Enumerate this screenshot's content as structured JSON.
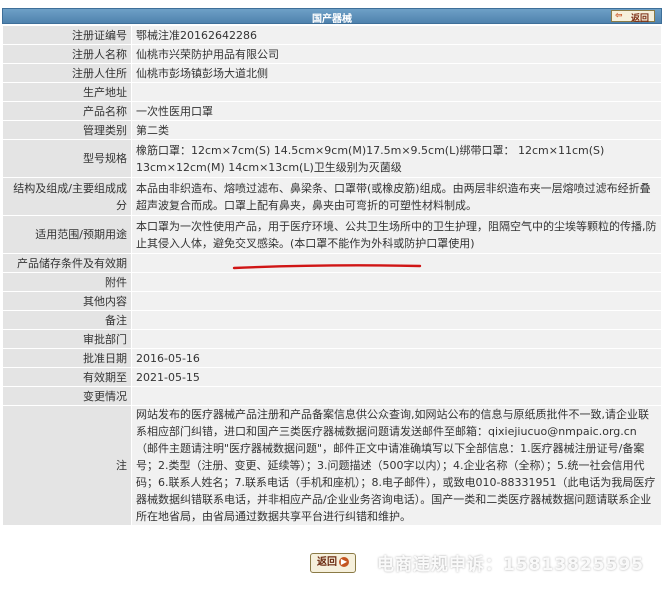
{
  "header": {
    "title": "国产器械",
    "back_label": "返回"
  },
  "rows": [
    {
      "label": "注册证编号",
      "value": "鄂械注准20162642286"
    },
    {
      "label": "注册人名称",
      "value": "仙桃市兴荣防护用品有限公司"
    },
    {
      "label": "注册人住所",
      "value": "仙桃市彭场镇彭场大道北侧"
    },
    {
      "label": "生产地址",
      "value": ""
    },
    {
      "label": "产品名称",
      "value": "一次性医用口罩"
    },
    {
      "label": "管理类别",
      "value": "第二类"
    },
    {
      "label": "型号规格",
      "value": "橡筋口罩：12cm×7cm(S) 14.5cm×9cm(M)17.5m×9.5cm(L)绑带口罩： 12cm×11cm(S) 13cm×12cm(M) 14cm×13cm(L)卫生级别为灭菌级"
    },
    {
      "label": "结构及组成/主要组成成分",
      "value": "本品由非织造布、熔喷过滤布、鼻梁条、口罩带(或橡皮筋)组成。由两层非织造布夹一层熔喷过滤布经折叠超声波复合而成。口罩上配有鼻夹，鼻夹由可弯折的可塑性材料制成。"
    },
    {
      "label": "适用范围/预期用途",
      "value": "本口罩为一次性使用产品，用于医疗环境、公共卫生场所中的卫生护理，阻隔空气中的尘埃等颗粒的传播,防止其侵入人体，避免交叉感染。(本口罩不能作为外科或防护口罩使用)"
    },
    {
      "label": "产品储存条件及有效期",
      "value": ""
    },
    {
      "label": "附件",
      "value": ""
    },
    {
      "label": "其他内容",
      "value": ""
    },
    {
      "label": "备注",
      "value": ""
    },
    {
      "label": "审批部门",
      "value": ""
    },
    {
      "label": "批准日期",
      "value": "2016-05-16"
    },
    {
      "label": "有效期至",
      "value": "2021-05-15"
    },
    {
      "label": "变更情况",
      "value": ""
    },
    {
      "label": "注",
      "value": "网站发布的医疗器械产品注册和产品备案信息供公众查询,如网站公布的信息与原纸质批件不一致,请企业联系相应部门纠错，进口和国产三类医疗器械数据问题请发送邮件至邮箱：qixiejiucuo@nmpaic.org.cn（邮件主题请注明\"医疗器械数据问题\"，邮件正文中请准确填写以下全部信息：1.医疗器械注册证号/备案号；2.类型（注册、变更、延续等）；3.问题描述（500字以内）；4.企业名称（全称）；5.统一社会信用代码；6.联系人姓名；7.联系电话（手机和座机）；8.电子邮件），或致电010-88331951（此电话为我局医疗器械数据纠错联系电话，并非相应产品/企业业务咨询电话）。国产一类和二类医疗器械数据问题请联系企业所在地省局，由省局通过数据共享平台进行纠错和维护。"
    }
  ],
  "footer": {
    "back_label": "返回"
  },
  "watermark": "电商违规申诉：15813825595",
  "colors": {
    "header": "#4f82ad",
    "label_bg": "#e4e4e4",
    "value_bg": "#f1f1f1",
    "underline": "#d01515"
  }
}
